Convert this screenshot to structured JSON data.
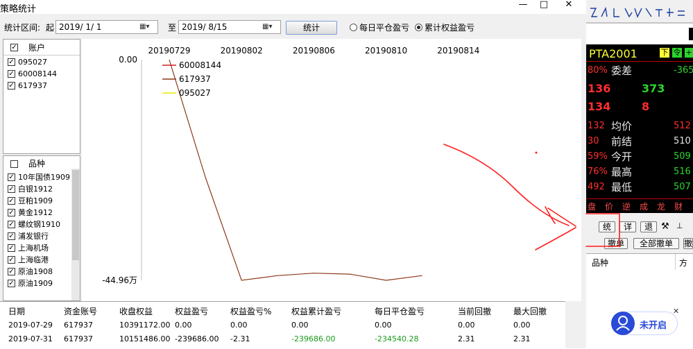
{
  "window": {
    "title": "策略统计",
    "minimize": "—",
    "maximize": "□",
    "close": "✕"
  },
  "toolbar": {
    "range_label": "统计区间:",
    "from_label": "起",
    "start_date": "2019/ 1/ 1",
    "to_label": "至",
    "end_date": "2019/ 8/15",
    "stat_button": "统计",
    "radio_daily": "每日平仓盈亏",
    "radio_cumulative": "累计权益盈亏",
    "selected_mode": "cumulative"
  },
  "accounts": {
    "header": "账户",
    "items": [
      "095027",
      "60008144",
      "617937"
    ]
  },
  "products": {
    "header": "品种",
    "items": [
      "10年国债1909",
      "白银1912",
      "豆粕1909",
      "黄金1912",
      "螺纹钢1910",
      "浦发银行",
      "上海机场",
      "上海临港",
      "原油1908",
      "原油1909"
    ]
  },
  "chart_data": {
    "type": "line",
    "x_ticks": [
      "20190729",
      "20190802",
      "20190806",
      "20190810",
      "20190814"
    ],
    "y_top_label": "0.00",
    "y_bottom_label": "-44.96万",
    "ylim": [
      -449600,
      0
    ],
    "legend": [
      "60008144",
      "617937",
      "095027"
    ],
    "series": [
      {
        "name": "617937",
        "x": [
          "20190729",
          "20190731",
          "20190802",
          "20190804",
          "20190806",
          "20190808",
          "20190810",
          "20190812"
        ],
        "values": [
          0,
          -239686,
          -449600,
          -440000,
          -435000,
          -437000,
          -449600,
          -440000
        ],
        "color": "#8b3a1a"
      },
      {
        "name": "60008144",
        "x": [],
        "values": [],
        "color": "#cc2222"
      },
      {
        "name": "095027",
        "x": [],
        "values": [],
        "color": "#e8e800"
      }
    ]
  },
  "table": {
    "columns": [
      "日期",
      "资金账号",
      "收盘权益",
      "权益盈亏",
      "权益盈亏%",
      "权益累计盈亏",
      "每日平仓盈亏",
      "当前回撤",
      "最大回撤"
    ],
    "rows": [
      [
        "2019-07-29",
        "617937",
        "10391172.00",
        "0.00",
        "0.00",
        "0.00",
        "0.00",
        "0.00",
        "0.00"
      ],
      [
        "2019-07-31",
        "617937",
        "10151486.00",
        "-239686.00",
        "-2.31",
        "-239686.00",
        "-234540.28",
        "2.31",
        "2.31"
      ]
    ]
  },
  "quote": {
    "symbol": "PTA2001",
    "badges": [
      "下",
      "令"
    ],
    "rows": [
      {
        "left": "80%",
        "label": "委差",
        "right": "-365"
      },
      {
        "left": "136",
        "mid": "373"
      },
      {
        "left": "134",
        "mid": "8"
      },
      {
        "left": "132",
        "label": "均价",
        "right": "512"
      },
      {
        "left": "30",
        "label": "前结",
        "right": "510"
      },
      {
        "left": "59%",
        "label": "今开",
        "right": "509"
      },
      {
        "left": "76%",
        "label": "最高",
        "right": "516"
      },
      {
        "left": "492",
        "label": "最低",
        "right": "507"
      }
    ],
    "tabs": [
      "盘",
      "价",
      "逆",
      "成",
      "龙",
      "财"
    ]
  },
  "order_panel": {
    "btn_stat": "统",
    "btn_detail": "详",
    "btn_back": "退",
    "btn_cancel": "撤单",
    "btn_cancel_all": "全部撤单",
    "btn_more": "撤",
    "col_product": "品种",
    "col_direction": "方向",
    "status_badge": "未开启"
  }
}
